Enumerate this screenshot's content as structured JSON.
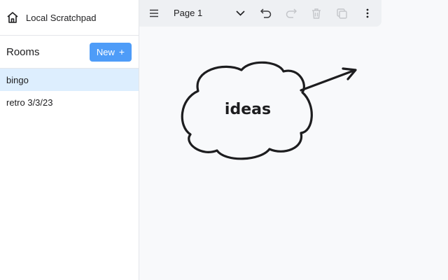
{
  "app": {
    "title": "Local Scratchpad"
  },
  "sidebar": {
    "rooms_title": "Rooms",
    "new_button_label": "New",
    "rooms": [
      {
        "name": "bingo",
        "active": true
      },
      {
        "name": "retro 3/3/23",
        "active": false
      }
    ]
  },
  "toolbar": {
    "page_name": "Page 1",
    "icons": [
      "menu-icon",
      "chevron-down-icon",
      "undo-icon",
      "redo-icon",
      "trash-icon",
      "duplicate-icon",
      "more-vertical-icon"
    ]
  },
  "canvas": {
    "shapes": [
      {
        "type": "cloud",
        "text": "ideas"
      },
      {
        "type": "arrow"
      }
    ]
  },
  "colors": {
    "accent": "#4e9cf8",
    "active_room_bg": "#ddeefe",
    "canvas_bg": "#f8f9fb",
    "toolbar_bg": "#eef0f3",
    "stroke": "#1d1d1f"
  }
}
